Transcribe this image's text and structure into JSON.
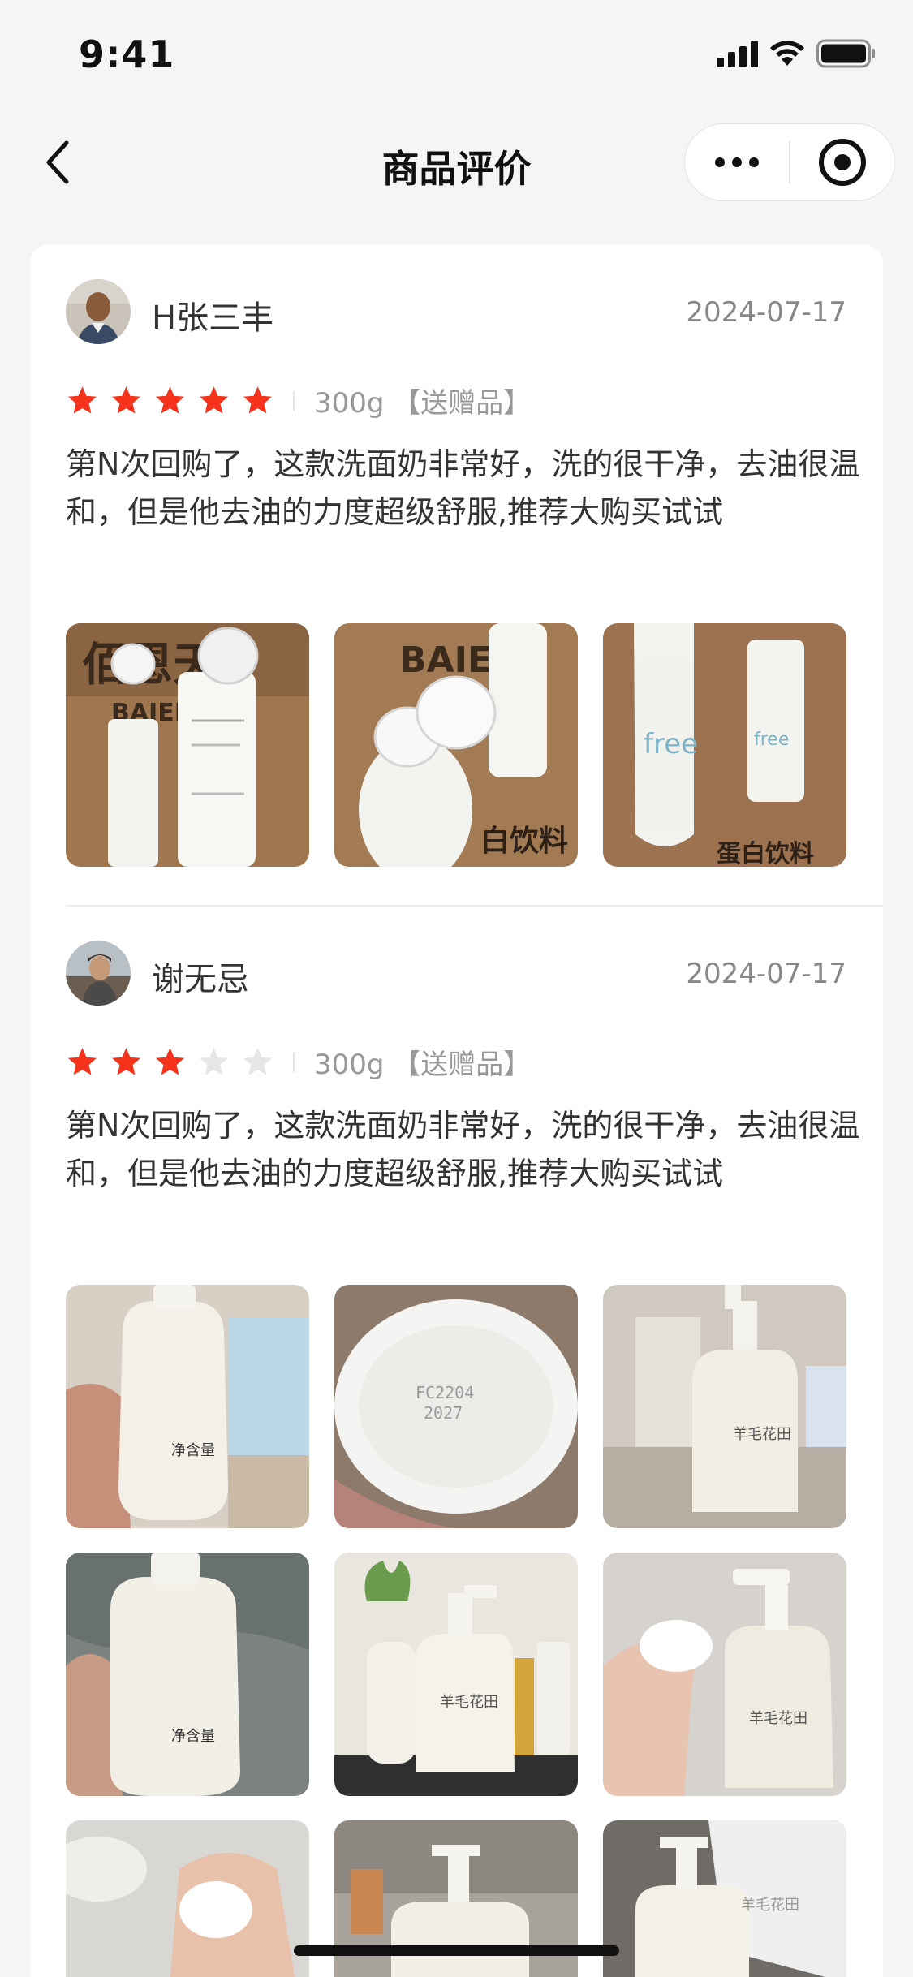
{
  "status_bar": {
    "time": "9:41",
    "icons": [
      "signal-icon",
      "wifi-icon",
      "battery-icon"
    ]
  },
  "nav": {
    "title": "商品评价",
    "back_icon": "chevron-left-icon",
    "more_icon": "more-dots-icon",
    "close_icon": "target-close-icon"
  },
  "colors": {
    "star_active": "#f5321c",
    "star_inactive": "#e6e6e6",
    "muted_text": "#999999"
  },
  "reviews": [
    {
      "user": "H张三丰",
      "date": "2024-07-17",
      "rating": 5,
      "max_rating": 5,
      "spec": "300g 【送赠品】",
      "text": "第N次回购了，这款洗面奶非常好，洗的很干净，去油很温和，但是他去油的力度超级舒服,推荐大购买试试",
      "photo_count": 3
    },
    {
      "user": "谢无忌",
      "date": "2024-07-17",
      "rating": 3,
      "max_rating": 5,
      "spec": "300g 【送赠品】",
      "text": "第N次回购了，这款洗面奶非常好，洗的很干净，去油很温和，但是他去油的力度超级舒服,推荐大购买试试",
      "photo_count": 9
    }
  ]
}
